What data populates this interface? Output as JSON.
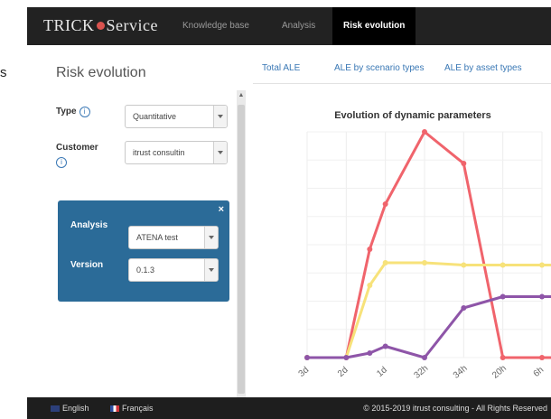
{
  "stray_text": "s",
  "navbar": {
    "brand_prefix": "TRICK",
    "brand_suffix": "Service",
    "items": [
      {
        "label": "Knowledge base",
        "active": false
      },
      {
        "label": "Analysis",
        "active": false
      },
      {
        "label": "Risk evolution",
        "active": true
      }
    ]
  },
  "page": {
    "title": "Risk evolution"
  },
  "tabs": [
    {
      "label": "Total ALE"
    },
    {
      "label": "ALE by scenario types"
    },
    {
      "label": "ALE by asset types"
    }
  ],
  "form": {
    "type_label": "Type",
    "type_value": "Quantitative",
    "customer_label": "Customer",
    "customer_value": "itrust consultin",
    "info_glyph": "i",
    "analysis_label": "Analysis",
    "analysis_value": "ATENA test",
    "version_label": "Version",
    "version_value": "0.1.3",
    "close_glyph": "×"
  },
  "chart_data": {
    "type": "line",
    "title": "Evolution of dynamic parameters",
    "xlabel": "",
    "ylabel": "",
    "categories": [
      "3d",
      "2d",
      "1d",
      "32h",
      "34h",
      "20h",
      "6h"
    ],
    "x": [
      0,
      1,
      1.6,
      2,
      3,
      4,
      5,
      6,
      7
    ],
    "ylim": [
      0,
      100
    ],
    "grid": true,
    "series": [
      {
        "color": "#f0646c",
        "values": [
          0,
          0,
          48,
          68,
          100,
          86,
          0,
          0,
          0
        ]
      },
      {
        "color": "#f7e27a",
        "values": [
          0,
          0,
          32,
          42,
          42,
          41,
          41,
          41,
          41
        ]
      },
      {
        "color": "#8e55a8",
        "values": [
          0,
          0,
          2,
          5,
          0,
          22,
          27,
          27,
          27
        ]
      }
    ]
  },
  "footer": {
    "english": "English",
    "francais": "Français",
    "copyright": "© 2015-2019 itrust consulting - All Rights Reserved"
  }
}
